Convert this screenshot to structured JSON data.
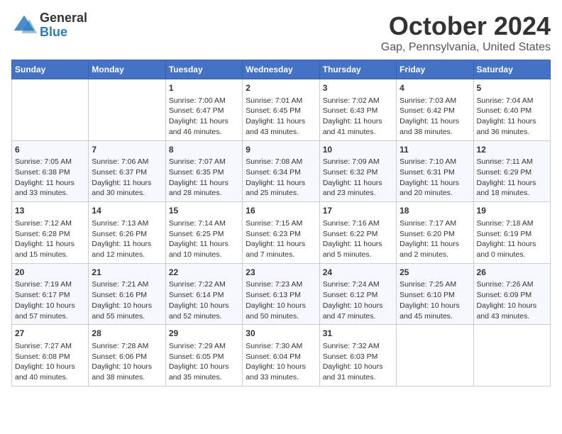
{
  "logo": {
    "general": "General",
    "blue": "Blue"
  },
  "title": "October 2024",
  "subtitle": "Gap, Pennsylvania, United States",
  "days": [
    "Sunday",
    "Monday",
    "Tuesday",
    "Wednesday",
    "Thursday",
    "Friday",
    "Saturday"
  ],
  "weeks": [
    [
      {
        "day": "",
        "content": ""
      },
      {
        "day": "",
        "content": ""
      },
      {
        "day": "1",
        "content": "Sunrise: 7:00 AM\nSunset: 6:47 PM\nDaylight: 11 hours and 46 minutes."
      },
      {
        "day": "2",
        "content": "Sunrise: 7:01 AM\nSunset: 6:45 PM\nDaylight: 11 hours and 43 minutes."
      },
      {
        "day": "3",
        "content": "Sunrise: 7:02 AM\nSunset: 6:43 PM\nDaylight: 11 hours and 41 minutes."
      },
      {
        "day": "4",
        "content": "Sunrise: 7:03 AM\nSunset: 6:42 PM\nDaylight: 11 hours and 38 minutes."
      },
      {
        "day": "5",
        "content": "Sunrise: 7:04 AM\nSunset: 6:40 PM\nDaylight: 11 hours and 36 minutes."
      }
    ],
    [
      {
        "day": "6",
        "content": "Sunrise: 7:05 AM\nSunset: 6:38 PM\nDaylight: 11 hours and 33 minutes."
      },
      {
        "day": "7",
        "content": "Sunrise: 7:06 AM\nSunset: 6:37 PM\nDaylight: 11 hours and 30 minutes."
      },
      {
        "day": "8",
        "content": "Sunrise: 7:07 AM\nSunset: 6:35 PM\nDaylight: 11 hours and 28 minutes."
      },
      {
        "day": "9",
        "content": "Sunrise: 7:08 AM\nSunset: 6:34 PM\nDaylight: 11 hours and 25 minutes."
      },
      {
        "day": "10",
        "content": "Sunrise: 7:09 AM\nSunset: 6:32 PM\nDaylight: 11 hours and 23 minutes."
      },
      {
        "day": "11",
        "content": "Sunrise: 7:10 AM\nSunset: 6:31 PM\nDaylight: 11 hours and 20 minutes."
      },
      {
        "day": "12",
        "content": "Sunrise: 7:11 AM\nSunset: 6:29 PM\nDaylight: 11 hours and 18 minutes."
      }
    ],
    [
      {
        "day": "13",
        "content": "Sunrise: 7:12 AM\nSunset: 6:28 PM\nDaylight: 11 hours and 15 minutes."
      },
      {
        "day": "14",
        "content": "Sunrise: 7:13 AM\nSunset: 6:26 PM\nDaylight: 11 hours and 12 minutes."
      },
      {
        "day": "15",
        "content": "Sunrise: 7:14 AM\nSunset: 6:25 PM\nDaylight: 11 hours and 10 minutes."
      },
      {
        "day": "16",
        "content": "Sunrise: 7:15 AM\nSunset: 6:23 PM\nDaylight: 11 hours and 7 minutes."
      },
      {
        "day": "17",
        "content": "Sunrise: 7:16 AM\nSunset: 6:22 PM\nDaylight: 11 hours and 5 minutes."
      },
      {
        "day": "18",
        "content": "Sunrise: 7:17 AM\nSunset: 6:20 PM\nDaylight: 11 hours and 2 minutes."
      },
      {
        "day": "19",
        "content": "Sunrise: 7:18 AM\nSunset: 6:19 PM\nDaylight: 11 hours and 0 minutes."
      }
    ],
    [
      {
        "day": "20",
        "content": "Sunrise: 7:19 AM\nSunset: 6:17 PM\nDaylight: 10 hours and 57 minutes."
      },
      {
        "day": "21",
        "content": "Sunrise: 7:21 AM\nSunset: 6:16 PM\nDaylight: 10 hours and 55 minutes."
      },
      {
        "day": "22",
        "content": "Sunrise: 7:22 AM\nSunset: 6:14 PM\nDaylight: 10 hours and 52 minutes."
      },
      {
        "day": "23",
        "content": "Sunrise: 7:23 AM\nSunset: 6:13 PM\nDaylight: 10 hours and 50 minutes."
      },
      {
        "day": "24",
        "content": "Sunrise: 7:24 AM\nSunset: 6:12 PM\nDaylight: 10 hours and 47 minutes."
      },
      {
        "day": "25",
        "content": "Sunrise: 7:25 AM\nSunset: 6:10 PM\nDaylight: 10 hours and 45 minutes."
      },
      {
        "day": "26",
        "content": "Sunrise: 7:26 AM\nSunset: 6:09 PM\nDaylight: 10 hours and 43 minutes."
      }
    ],
    [
      {
        "day": "27",
        "content": "Sunrise: 7:27 AM\nSunset: 6:08 PM\nDaylight: 10 hours and 40 minutes."
      },
      {
        "day": "28",
        "content": "Sunrise: 7:28 AM\nSunset: 6:06 PM\nDaylight: 10 hours and 38 minutes."
      },
      {
        "day": "29",
        "content": "Sunrise: 7:29 AM\nSunset: 6:05 PM\nDaylight: 10 hours and 35 minutes."
      },
      {
        "day": "30",
        "content": "Sunrise: 7:30 AM\nSunset: 6:04 PM\nDaylight: 10 hours and 33 minutes."
      },
      {
        "day": "31",
        "content": "Sunrise: 7:32 AM\nSunset: 6:03 PM\nDaylight: 10 hours and 31 minutes."
      },
      {
        "day": "",
        "content": ""
      },
      {
        "day": "",
        "content": ""
      }
    ]
  ]
}
